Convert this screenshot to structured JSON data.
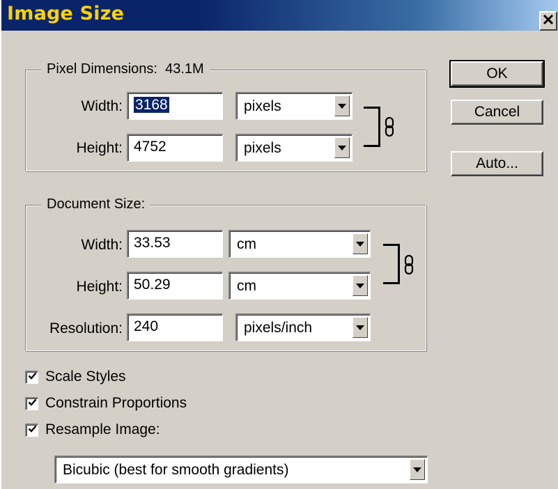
{
  "window": {
    "title": "Image Size"
  },
  "buttons": {
    "ok": "OK",
    "cancel": "Cancel",
    "auto": "Auto..."
  },
  "pixel_dimensions": {
    "legend": "Pixel Dimensions:",
    "size": "43.1M",
    "width_label": "Width:",
    "width_value": "3168",
    "width_unit": "pixels",
    "height_label": "Height:",
    "height_value": "4752",
    "height_unit": "pixels"
  },
  "document_size": {
    "legend": "Document Size:",
    "width_label": "Width:",
    "width_value": "33.53",
    "width_unit": "cm",
    "height_label": "Height:",
    "height_value": "50.29",
    "height_unit": "cm",
    "resolution_label": "Resolution:",
    "resolution_value": "240",
    "resolution_unit": "pixels/inch"
  },
  "options": {
    "scale_styles": {
      "label": "Scale Styles",
      "checked": true
    },
    "constrain_proportions": {
      "label": "Constrain Proportions",
      "checked": true
    },
    "resample_image": {
      "label": "Resample Image:",
      "checked": true
    },
    "resample_method": "Bicubic (best for smooth gradients)"
  },
  "colors": {
    "title_text": "#ffd200",
    "title_bar": "#0a246a",
    "face": "#d4d0c8",
    "selection": "#0a246a"
  },
  "icons": {
    "close": "close-icon",
    "link": "chain-link-icon",
    "check": "checkmark-icon",
    "dropdown": "chevron-down-icon"
  }
}
